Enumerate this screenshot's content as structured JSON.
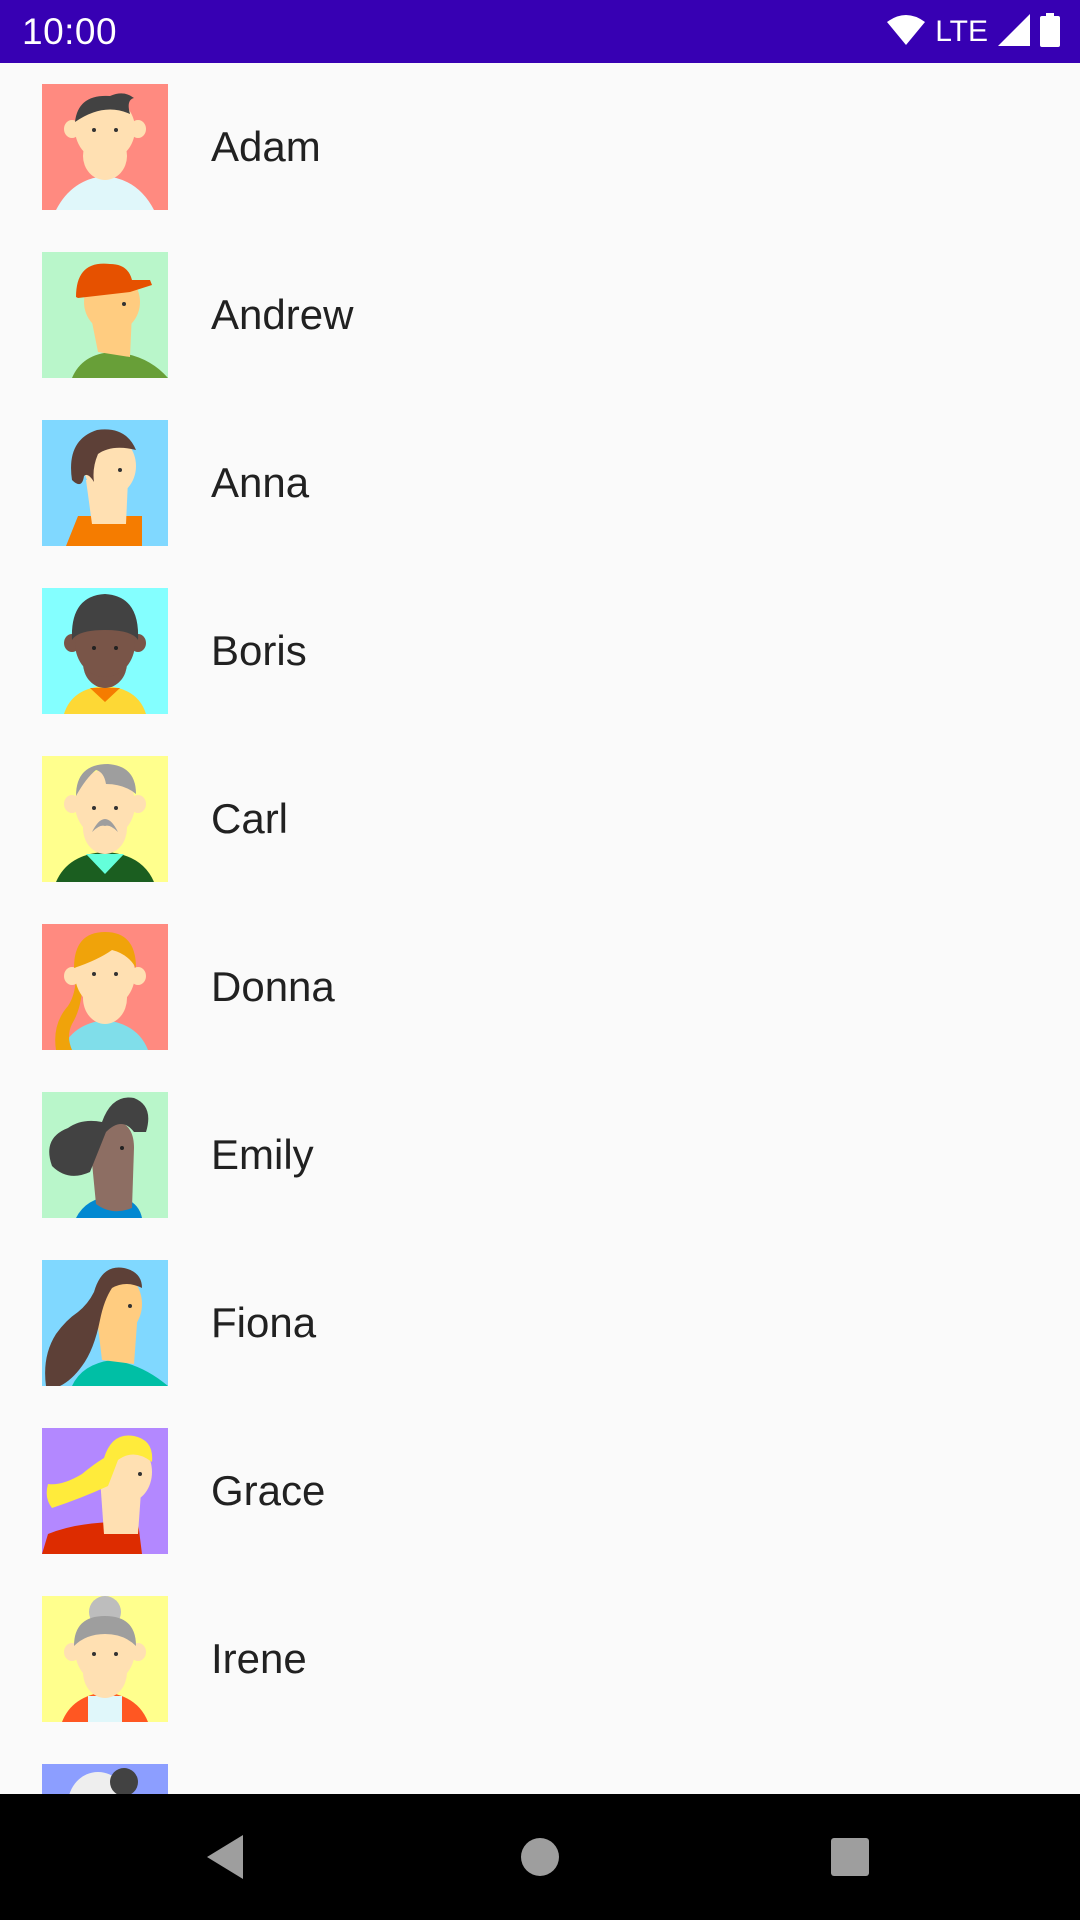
{
  "status_bar": {
    "time": "10:00",
    "network": "LTE",
    "icons": [
      "wifi-icon",
      "signal-icon",
      "battery-icon"
    ]
  },
  "contacts": [
    {
      "name": "Adam",
      "avatar_bg": "#ff8a80"
    },
    {
      "name": "Andrew",
      "avatar_bg": "#b9f6ca"
    },
    {
      "name": "Anna",
      "avatar_bg": "#80d8ff"
    },
    {
      "name": "Boris",
      "avatar_bg": "#84ffff"
    },
    {
      "name": "Carl",
      "avatar_bg": "#ffff8d"
    },
    {
      "name": "Donna",
      "avatar_bg": "#ff8a80"
    },
    {
      "name": "Emily",
      "avatar_bg": "#b9f6ca"
    },
    {
      "name": "Fiona",
      "avatar_bg": "#80d8ff"
    },
    {
      "name": "Grace",
      "avatar_bg": "#b388ff"
    },
    {
      "name": "Irene",
      "avatar_bg": "#ffff8d"
    },
    {
      "name": "",
      "avatar_bg": "#8c9eff"
    }
  ],
  "nav_bar": {
    "buttons": [
      "back-icon",
      "home-icon",
      "recents-icon"
    ]
  },
  "colors": {
    "status_bar": "#3700b3",
    "background": "#fafafa",
    "text": "#212121",
    "nav_bar": "#000000"
  }
}
